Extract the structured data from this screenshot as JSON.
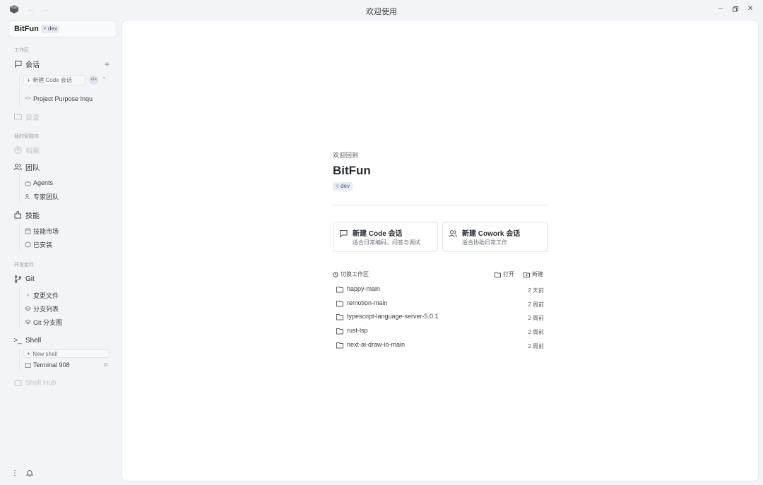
{
  "window": {
    "title": "欢迎使用",
    "back_icon": "arrow-left-icon",
    "forward_icon": "arrow-right-icon",
    "controls": [
      "minimize-icon",
      "restore-icon",
      "close-icon"
    ]
  },
  "sidebar": {
    "workspace_name": "BitFun",
    "workspace_branch": "dev",
    "section_workspace": "工作区",
    "sessions_label": "会话",
    "new_code_session": "新建 Code 会话",
    "session_items": [
      "Project Purpose Inqu"
    ],
    "directory_label": "目录",
    "section_agents": "我的智能体",
    "profile_label": "档案",
    "team_label": "团队",
    "team_items": [
      "Agents",
      "专家团队"
    ],
    "skills_label": "技能",
    "skills_items": [
      "技能市场",
      "已安装"
    ],
    "section_devkit": "开发套件",
    "git_label": "Git",
    "git_items": [
      "变更文件",
      "分支列表",
      "Git 分支图"
    ],
    "shell_label": "Shell",
    "new_shell": "New shell",
    "terminal_items": [
      "Terminal 908"
    ],
    "shell_hub_label": "Shell Hub"
  },
  "main": {
    "welcome_back": "欢迎回到",
    "workspace_name": "BitFun",
    "branch": "dev",
    "cards": [
      {
        "title": "新建 Code 会话",
        "desc": "适合日常编码、问答与调试",
        "icon": "chat-icon"
      },
      {
        "title": "新建 Cowork 会话",
        "desc": "适合协助日常工作",
        "icon": "users-icon"
      }
    ],
    "switch_workspace": "切换工作区",
    "open_label": "打开",
    "new_label": "新建",
    "workspaces": [
      {
        "name": "happy-main",
        "time": "2 天前"
      },
      {
        "name": "remotion-main",
        "time": "2 周前"
      },
      {
        "name": "typescript-language-server-5.0.1",
        "time": "2 周前"
      },
      {
        "name": "rust-lsp",
        "time": "2 周前"
      },
      {
        "name": "next-ai-draw-io-main",
        "time": "2 周前"
      }
    ]
  }
}
